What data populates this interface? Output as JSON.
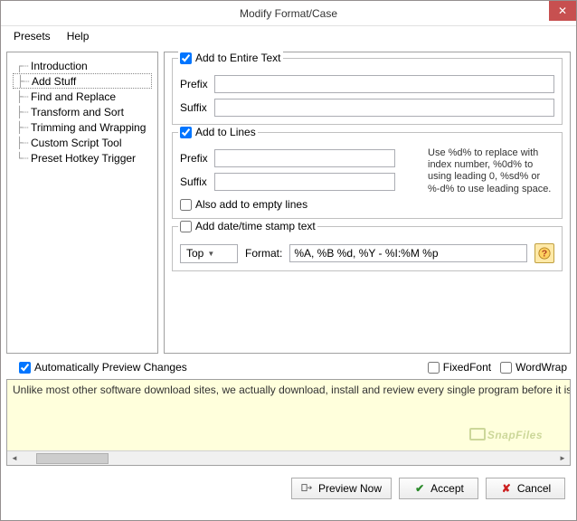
{
  "window": {
    "title": "Modify Format/Case"
  },
  "menu": {
    "presets": "Presets",
    "help": "Help"
  },
  "sidebar": {
    "items": [
      {
        "label": "Introduction"
      },
      {
        "label": "Add Stuff"
      },
      {
        "label": "Find and Replace"
      },
      {
        "label": "Transform and Sort"
      },
      {
        "label": "Trimming and Wrapping"
      },
      {
        "label": "Custom Script Tool"
      },
      {
        "label": "Preset Hotkey Trigger"
      }
    ],
    "selected_index": 1
  },
  "entire_text": {
    "title": "Add to Entire Text",
    "checked": true,
    "prefix_label": "Prefix",
    "prefix_value": "",
    "suffix_label": "Suffix",
    "suffix_value": ""
  },
  "lines": {
    "title": "Add to Lines",
    "checked": true,
    "prefix_label": "Prefix",
    "prefix_value": "",
    "suffix_label": "Suffix",
    "suffix_value": "",
    "hint": "Use %d% to replace with index number, %0d% to using leading 0, %sd% or %-d% to use leading space.",
    "empty_label": "Also add to empty lines",
    "empty_checked": false
  },
  "date": {
    "title": "Add date/time stamp text",
    "checked": false,
    "position_label": "Top",
    "format_label": "Format:",
    "format_value": "%A, %B %d, %Y - %I:%M %p"
  },
  "options": {
    "auto_preview_label": "Automatically Preview Changes",
    "auto_preview_checked": true,
    "fixed_font_label": "FixedFont",
    "fixed_font_checked": false,
    "word_wrap_label": "WordWrap",
    "word_wrap_checked": false
  },
  "preview": {
    "text": "Unlike most other software download sites, we actually download, install and review every single program before it is listed on the sit",
    "watermark": "SnapFiles"
  },
  "buttons": {
    "preview_now": "Preview Now",
    "accept": "Accept",
    "cancel": "Cancel"
  }
}
